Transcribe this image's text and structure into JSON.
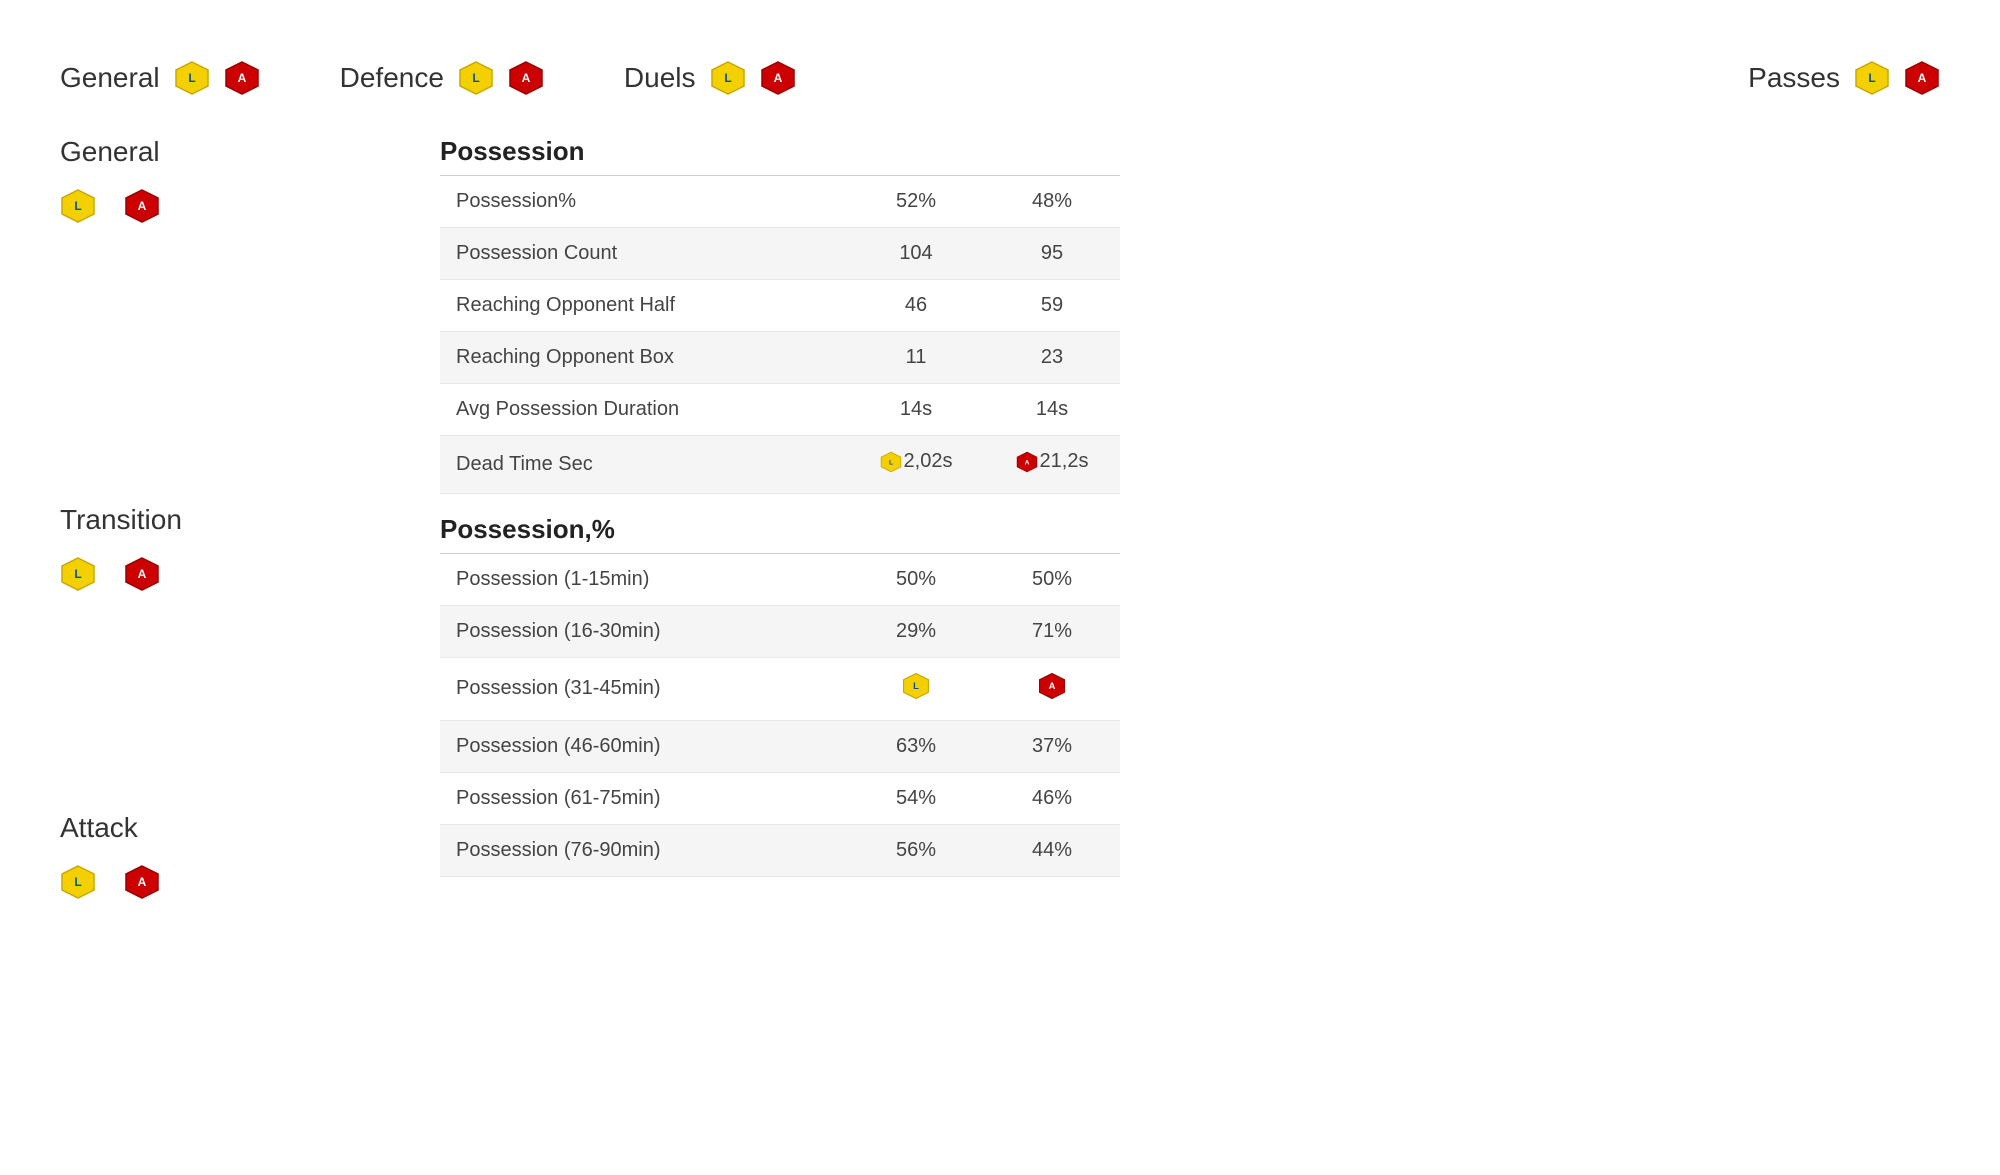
{
  "nav": {
    "sections": [
      {
        "id": "general",
        "label": "General"
      },
      {
        "id": "defence",
        "label": "Defence"
      },
      {
        "id": "duels",
        "label": "Duels"
      },
      {
        "id": "passes",
        "label": "Passes"
      }
    ]
  },
  "sidebar": {
    "sections": [
      {
        "id": "general",
        "label": "General",
        "showBadges": true
      },
      {
        "id": "transition",
        "label": "Transition",
        "showBadges": true,
        "offsetTop": 260
      },
      {
        "id": "attack",
        "label": "Attack",
        "showBadges": true
      }
    ]
  },
  "possession_table": {
    "title": "Possession",
    "rows": [
      {
        "label": "Possession%",
        "val1": "52%",
        "val2": "48%",
        "even": false
      },
      {
        "label": "Possession Count",
        "val1": "104",
        "val2": "95",
        "even": true
      },
      {
        "label": "Reaching Opponent Half",
        "val1": "46",
        "val2": "59",
        "even": false
      },
      {
        "label": "Reaching Opponent Box",
        "val1": "11",
        "val2": "23",
        "even": true
      },
      {
        "label": "Avg Possession Duration",
        "val1": "14s",
        "val2": "14s",
        "even": false
      },
      {
        "label": "Dead Time Sec",
        "val1": "2,02s",
        "val2": "21,2s",
        "even": true,
        "hasBadge": true
      }
    ]
  },
  "possession_pct_table": {
    "title": "Possession,%",
    "rows": [
      {
        "label": "Possession (1-15min)",
        "val1": "50%",
        "val2": "50%",
        "even": false
      },
      {
        "label": "Possession (16-30min)",
        "val1": "29%",
        "val2": "71%",
        "even": true
      },
      {
        "label": "Possession (31-45min)",
        "val1": "",
        "val2": "",
        "even": false,
        "hasBadge": true
      },
      {
        "label": "Possession (46-60min)",
        "val1": "63%",
        "val2": "37%",
        "even": true
      },
      {
        "label": "Possession (61-75min)",
        "val1": "54%",
        "val2": "46%",
        "even": false
      },
      {
        "label": "Possession (76-90min)",
        "val1": "56%",
        "val2": "44%",
        "even": true
      }
    ]
  }
}
